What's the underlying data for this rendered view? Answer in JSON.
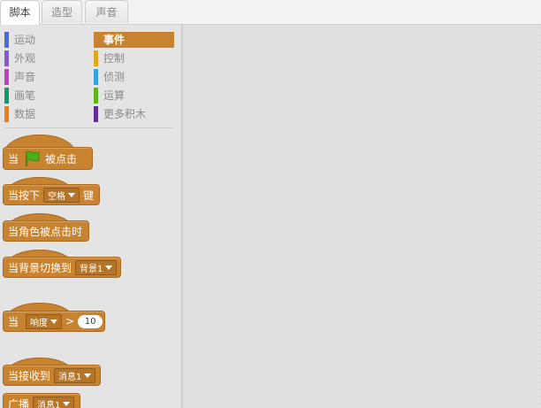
{
  "tabs": [
    {
      "label": "脚本",
      "active": true
    },
    {
      "label": "造型",
      "active": false
    },
    {
      "label": "声音",
      "active": false
    }
  ],
  "categories": [
    {
      "label": "运动",
      "color": "#4a6cd4",
      "selected": false
    },
    {
      "label": "事件",
      "color": "#c88330",
      "selected": true
    },
    {
      "label": "外观",
      "color": "#8a55d7",
      "selected": false
    },
    {
      "label": "控制",
      "color": "#e1a91a",
      "selected": false
    },
    {
      "label": "声音",
      "color": "#bb42c3",
      "selected": false
    },
    {
      "label": "侦测",
      "color": "#2ca5e2",
      "selected": false
    },
    {
      "label": "画笔",
      "color": "#0e9a6c",
      "selected": false
    },
    {
      "label": "运算",
      "color": "#5cb712",
      "selected": false
    },
    {
      "label": "数据",
      "color": "#ee7d16",
      "selected": false
    },
    {
      "label": "更多积木",
      "color": "#632d99",
      "selected": false
    }
  ],
  "blocks": {
    "when_flag": {
      "prefix": "当",
      "suffix": "被点击",
      "icon": "green-flag-icon"
    },
    "when_key": {
      "prefix": "当按下",
      "key": "空格",
      "suffix": "键"
    },
    "when_sprite_clicked": {
      "label": "当角色被点击时"
    },
    "when_backdrop": {
      "prefix": "当背景切换到",
      "value": "背景1"
    },
    "when_sensor": {
      "prefix": "当",
      "sensor": "响度",
      "op": ">",
      "value": "10"
    },
    "when_receive": {
      "prefix": "当接收到",
      "message": "消息1"
    },
    "broadcast": {
      "prefix": "广播",
      "message": "消息1"
    }
  },
  "colors": {
    "event": "#c88330",
    "flag": "#4caf1a"
  }
}
